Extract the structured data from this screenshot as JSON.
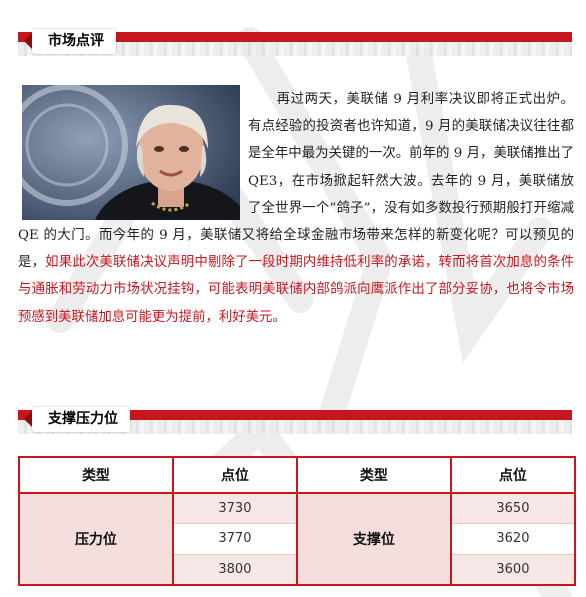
{
  "sections": {
    "market_review_title": "市场点评",
    "support_resistance_title": "支撑压力位"
  },
  "article": {
    "p1": "再过两天，美联储 9 月利率决议即将正式出炉。有点经验的投资者也许知道，9 月的美联储决议往往都是全年中最为关键的一次。前年的 9 月，美联储推出了 QE3，在市场掀起轩然大波。去年的 9 月，美联储放了全世界一个“鸽子”，没有如多数投行预期般打开缩减 QE 的大门。而今年的 9 月，美联储又将给全球金融市场带来怎样的新变化呢？可以预见的是，",
    "p1_red": "如果此次美联储决议声明中剔除了一段时期内维持低利率的承诺，转而将首次加息的条件与通胀和劳动力市场状况挂钩，可能表明美联储内部鸽派向鹰派作出了部分妥协，也将令市场预感到美联储加息可能更为提前，利好美元。"
  },
  "table": {
    "headers": [
      "类型",
      "点位",
      "类型",
      "点位"
    ],
    "resistance_label": "压力位",
    "support_label": "支撑位",
    "resistance_values": [
      "3730",
      "3770",
      "3800"
    ],
    "support_values": [
      "3650",
      "3620",
      "3600"
    ]
  },
  "colors": {
    "accent_red": "#c8161d"
  }
}
